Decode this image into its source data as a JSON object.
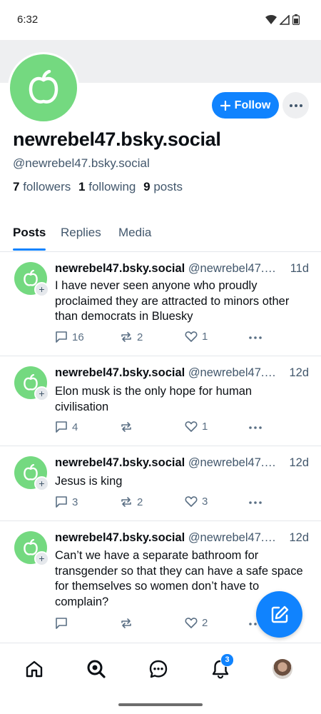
{
  "status_bar": {
    "time": "6:32"
  },
  "profile": {
    "display_name": "newrebel47.bsky.social",
    "handle": "@newrebel47.bsky.social",
    "followers_count": "7",
    "followers_label": "followers",
    "following_count": "1",
    "following_label": "following",
    "posts_count": "9",
    "posts_label": "posts",
    "follow_label": "Follow"
  },
  "tabs": [
    {
      "label": "Posts",
      "active": true
    },
    {
      "label": "Replies",
      "active": false
    },
    {
      "label": "Media",
      "active": false
    }
  ],
  "posts": [
    {
      "author": "newrebel47.bsky.social",
      "handle": "@newrebel47.…",
      "time": "11d",
      "text": "I have never seen anyone who proudly proclaimed they are attracted to minors other than democrats in Bluesky",
      "replies": "16",
      "reposts": "2",
      "likes": "1"
    },
    {
      "author": "newrebel47.bsky.social",
      "handle": "@newrebel47.…",
      "time": "12d",
      "text": "Elon musk is the only hope for human civilisation",
      "replies": "4",
      "reposts": "",
      "likes": "1"
    },
    {
      "author": "newrebel47.bsky.social",
      "handle": "@newrebel47.…",
      "time": "12d",
      "text": "Jesus is king",
      "replies": "3",
      "reposts": "2",
      "likes": "3"
    },
    {
      "author": "newrebel47.bsky.social",
      "handle": "@newrebel47.…",
      "time": "12d",
      "text": "Can’t we have a separate bathroom for transgender so that they can have a safe space for themselves so women don’t have to complain?",
      "replies": "",
      "reposts": "",
      "likes": "2"
    }
  ],
  "bottom_nav": {
    "items": [
      "home-icon",
      "search-icon",
      "chat-icon",
      "bell-icon",
      "profile-avatar"
    ],
    "notifications_badge": "3"
  },
  "colors": {
    "accent": "#1083fe",
    "avatar_green": "#74d980",
    "muted": "#42576c"
  }
}
